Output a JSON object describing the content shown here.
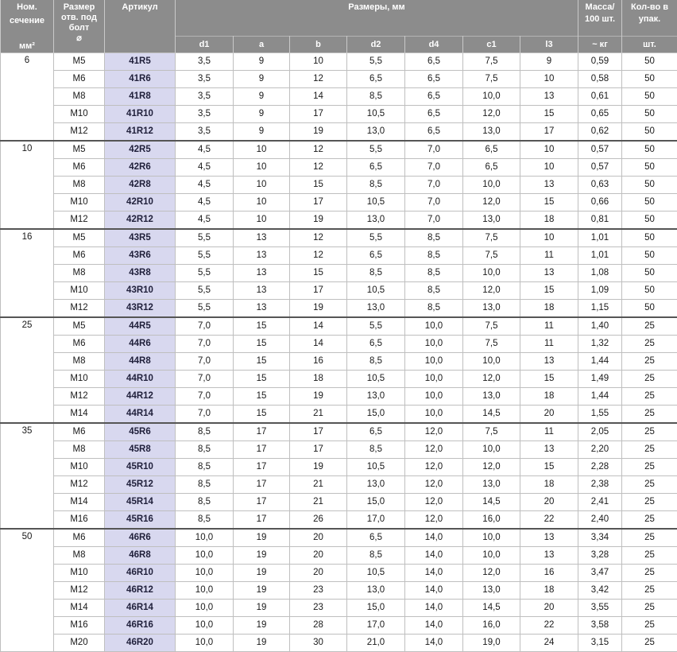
{
  "headers": {
    "section_line1": "Ном.",
    "section_line2": "сечение",
    "section_unit": "мм²",
    "bolt_line1": "Размер",
    "bolt_line2": "отв. под",
    "bolt_line3": "болт",
    "bolt_unit": "⌀",
    "article": "Артикул",
    "dims": "Размеры, мм",
    "mass_line1": "Масса/",
    "mass_line2": "100 шт.",
    "mass_unit": "~ кг",
    "qty_line1": "Кол-во в",
    "qty_line2": "упак.",
    "qty_unit": "шт.",
    "dim_cols": [
      "d1",
      "a",
      "b",
      "d2",
      "d4",
      "c1",
      "l3"
    ]
  },
  "groups": [
    {
      "section": "6",
      "rows": [
        [
          "M5",
          "41R5",
          "3,5",
          "9",
          "10",
          "5,5",
          "6,5",
          "7,5",
          "9",
          "0,59",
          "50"
        ],
        [
          "M6",
          "41R6",
          "3,5",
          "9",
          "12",
          "6,5",
          "6,5",
          "7,5",
          "10",
          "0,58",
          "50"
        ],
        [
          "M8",
          "41R8",
          "3,5",
          "9",
          "14",
          "8,5",
          "6,5",
          "10,0",
          "13",
          "0,61",
          "50"
        ],
        [
          "M10",
          "41R10",
          "3,5",
          "9",
          "17",
          "10,5",
          "6,5",
          "12,0",
          "15",
          "0,65",
          "50"
        ],
        [
          "M12",
          "41R12",
          "3,5",
          "9",
          "19",
          "13,0",
          "6,5",
          "13,0",
          "17",
          "0,62",
          "50"
        ]
      ]
    },
    {
      "section": "10",
      "rows": [
        [
          "M5",
          "42R5",
          "4,5",
          "10",
          "12",
          "5,5",
          "7,0",
          "6,5",
          "10",
          "0,57",
          "50"
        ],
        [
          "M6",
          "42R6",
          "4,5",
          "10",
          "12",
          "6,5",
          "7,0",
          "6,5",
          "10",
          "0,57",
          "50"
        ],
        [
          "M8",
          "42R8",
          "4,5",
          "10",
          "15",
          "8,5",
          "7,0",
          "10,0",
          "13",
          "0,63",
          "50"
        ],
        [
          "M10",
          "42R10",
          "4,5",
          "10",
          "17",
          "10,5",
          "7,0",
          "12,0",
          "15",
          "0,66",
          "50"
        ],
        [
          "M12",
          "42R12",
          "4,5",
          "10",
          "19",
          "13,0",
          "7,0",
          "13,0",
          "18",
          "0,81",
          "50"
        ]
      ]
    },
    {
      "section": "16",
      "rows": [
        [
          "M5",
          "43R5",
          "5,5",
          "13",
          "12",
          "5,5",
          "8,5",
          "7,5",
          "10",
          "1,01",
          "50"
        ],
        [
          "M6",
          "43R6",
          "5,5",
          "13",
          "12",
          "6,5",
          "8,5",
          "7,5",
          "11",
          "1,01",
          "50"
        ],
        [
          "M8",
          "43R8",
          "5,5",
          "13",
          "15",
          "8,5",
          "8,5",
          "10,0",
          "13",
          "1,08",
          "50"
        ],
        [
          "M10",
          "43R10",
          "5,5",
          "13",
          "17",
          "10,5",
          "8,5",
          "12,0",
          "15",
          "1,09",
          "50"
        ],
        [
          "M12",
          "43R12",
          "5,5",
          "13",
          "19",
          "13,0",
          "8,5",
          "13,0",
          "18",
          "1,15",
          "50"
        ]
      ]
    },
    {
      "section": "25",
      "rows": [
        [
          "M5",
          "44R5",
          "7,0",
          "15",
          "14",
          "5,5",
          "10,0",
          "7,5",
          "11",
          "1,40",
          "25"
        ],
        [
          "M6",
          "44R6",
          "7,0",
          "15",
          "14",
          "6,5",
          "10,0",
          "7,5",
          "11",
          "1,32",
          "25"
        ],
        [
          "M8",
          "44R8",
          "7,0",
          "15",
          "16",
          "8,5",
          "10,0",
          "10,0",
          "13",
          "1,44",
          "25"
        ],
        [
          "M10",
          "44R10",
          "7,0",
          "15",
          "18",
          "10,5",
          "10,0",
          "12,0",
          "15",
          "1,49",
          "25"
        ],
        [
          "M12",
          "44R12",
          "7,0",
          "15",
          "19",
          "13,0",
          "10,0",
          "13,0",
          "18",
          "1,44",
          "25"
        ],
        [
          "M14",
          "44R14",
          "7,0",
          "15",
          "21",
          "15,0",
          "10,0",
          "14,5",
          "20",
          "1,55",
          "25"
        ]
      ]
    },
    {
      "section": "35",
      "rows": [
        [
          "M6",
          "45R6",
          "8,5",
          "17",
          "17",
          "6,5",
          "12,0",
          "7,5",
          "11",
          "2,05",
          "25"
        ],
        [
          "M8",
          "45R8",
          "8,5",
          "17",
          "17",
          "8,5",
          "12,0",
          "10,0",
          "13",
          "2,20",
          "25"
        ],
        [
          "M10",
          "45R10",
          "8,5",
          "17",
          "19",
          "10,5",
          "12,0",
          "12,0",
          "15",
          "2,28",
          "25"
        ],
        [
          "M12",
          "45R12",
          "8,5",
          "17",
          "21",
          "13,0",
          "12,0",
          "13,0",
          "18",
          "2,38",
          "25"
        ],
        [
          "M14",
          "45R14",
          "8,5",
          "17",
          "21",
          "15,0",
          "12,0",
          "14,5",
          "20",
          "2,41",
          "25"
        ],
        [
          "M16",
          "45R16",
          "8,5",
          "17",
          "26",
          "17,0",
          "12,0",
          "16,0",
          "22",
          "2,40",
          "25"
        ]
      ]
    },
    {
      "section": "50",
      "rows": [
        [
          "M6",
          "46R6",
          "10,0",
          "19",
          "20",
          "6,5",
          "14,0",
          "10,0",
          "13",
          "3,34",
          "25"
        ],
        [
          "M8",
          "46R8",
          "10,0",
          "19",
          "20",
          "8,5",
          "14,0",
          "10,0",
          "13",
          "3,28",
          "25"
        ],
        [
          "M10",
          "46R10",
          "10,0",
          "19",
          "20",
          "10,5",
          "14,0",
          "12,0",
          "16",
          "3,47",
          "25"
        ],
        [
          "M12",
          "46R12",
          "10,0",
          "19",
          "23",
          "13,0",
          "14,0",
          "13,0",
          "18",
          "3,42",
          "25"
        ],
        [
          "M14",
          "46R14",
          "10,0",
          "19",
          "23",
          "15,0",
          "14,0",
          "14,5",
          "20",
          "3,55",
          "25"
        ],
        [
          "M16",
          "46R16",
          "10,0",
          "19",
          "28",
          "17,0",
          "14,0",
          "16,0",
          "22",
          "3,58",
          "25"
        ],
        [
          "M20",
          "46R20",
          "10,0",
          "19",
          "30",
          "21,0",
          "14,0",
          "19,0",
          "24",
          "3,15",
          "25"
        ]
      ]
    }
  ]
}
